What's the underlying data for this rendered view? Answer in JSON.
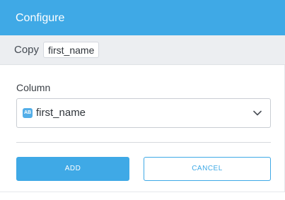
{
  "dialog": {
    "title": "Configure",
    "subheader": {
      "prefix": "Copy",
      "chip": "first_name"
    },
    "column_field": {
      "label": "Column",
      "type_icon": "text-type-icon",
      "type_icon_text": "AB",
      "value": "first_name",
      "dropdown_icon": "chevron-down-icon"
    },
    "buttons": {
      "add": "ADD",
      "cancel": "CANCEL"
    }
  },
  "colors": {
    "accent": "#3fa9e6",
    "subheader_bg": "#eceef1"
  }
}
